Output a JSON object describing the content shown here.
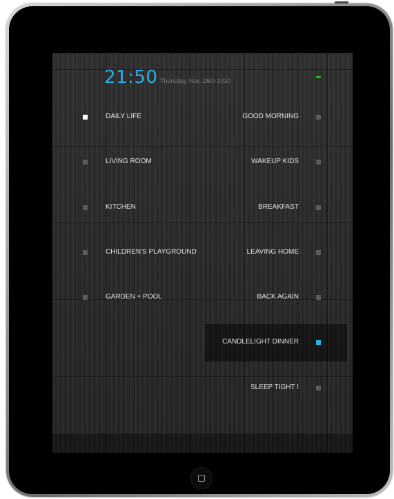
{
  "header": {
    "time": "21:50",
    "date": "Thursday, Nov. 26th 2010"
  },
  "left_menu": [
    {
      "label": "DAILY LIFE",
      "active": true
    },
    {
      "label": "LIVING ROOM",
      "active": false
    },
    {
      "label": "KITCHEN",
      "active": false
    },
    {
      "label": "CHILDREN'S PLAYGROUND",
      "active": false
    },
    {
      "label": "GARDEN + POOL",
      "active": false
    }
  ],
  "right_menu": [
    {
      "label": "GOOD MORNING",
      "selected": false
    },
    {
      "label": "WAKEUP KIDS",
      "selected": false
    },
    {
      "label": "BREAKFAST",
      "selected": false
    },
    {
      "label": "LEAVING HOME",
      "selected": false
    },
    {
      "label": "BACK AGAIN",
      "selected": false
    },
    {
      "label": "CANDLELIGHT DINNER",
      "selected": true
    },
    {
      "label": "SLEEP TIGHT !",
      "selected": false
    }
  ],
  "footer": {
    "text": ""
  },
  "colors": {
    "accent": "#2aaee6",
    "status_led": "#19c51d",
    "active_indicator": "#ffffff",
    "inactive_indicator": "#5b5b5b"
  },
  "icons": {
    "status": "status-led-icon",
    "home": "home-button-icon"
  }
}
